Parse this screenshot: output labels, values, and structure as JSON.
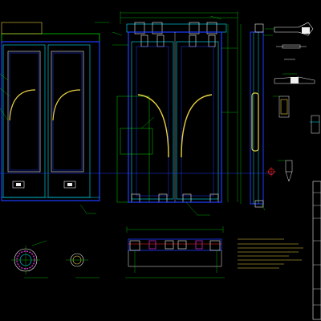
{
  "drawing": {
    "background": "#000000",
    "palette": {
      "frame_blue": "#1f3cff",
      "frame_cyan": "#00e5ff",
      "leader_green": "#00d000",
      "arch_yellow": "#e8d040",
      "white": "#f0f0f0",
      "magenta": "#ff30ff",
      "red": "#ff2020"
    },
    "views": [
      {
        "id": "left-elevation",
        "label": ""
      },
      {
        "id": "front-elevation",
        "label": ""
      },
      {
        "id": "side-section",
        "label": ""
      },
      {
        "id": "handle-details",
        "label": ""
      },
      {
        "id": "plan-section",
        "label": ""
      },
      {
        "id": "round-details",
        "label": ""
      },
      {
        "id": "notes-block",
        "label": ""
      },
      {
        "id": "title-block",
        "label": ""
      }
    ],
    "icons": [
      "crosshair-icon",
      "section-marker-icon",
      "handle-detail-icon",
      "ring-detail-icon"
    ]
  }
}
